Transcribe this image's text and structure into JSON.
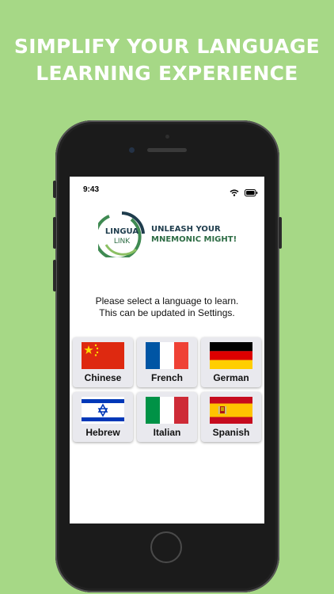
{
  "headline": {
    "line1": "SIMPLIFY YOUR LANGUAGE",
    "line2": "LEARNING EXPERIENCE"
  },
  "status_bar": {
    "time": "9:43",
    "icons": [
      "wifi-icon",
      "battery-icon"
    ]
  },
  "logo": {
    "brand_line1": "LINGUA",
    "brand_line2": "LINK",
    "tagline_line1": "UNLEASH YOUR",
    "tagline_line2": "MNEMONIC MIGHT!"
  },
  "prompt": {
    "line1": "Please select a language to learn.",
    "line2": "This can be updated in Settings."
  },
  "languages": [
    {
      "label": "Chinese",
      "flag": "china-flag"
    },
    {
      "label": "French",
      "flag": "france-flag"
    },
    {
      "label": "German",
      "flag": "germany-flag"
    },
    {
      "label": "Hebrew",
      "flag": "israel-flag"
    },
    {
      "label": "Italian",
      "flag": "italy-flag"
    },
    {
      "label": "Spanish",
      "flag": "spain-flag"
    }
  ],
  "colors": {
    "background": "#a6d886",
    "brand_green": "#2e6d45",
    "brand_navy": "#1f3d4d"
  }
}
